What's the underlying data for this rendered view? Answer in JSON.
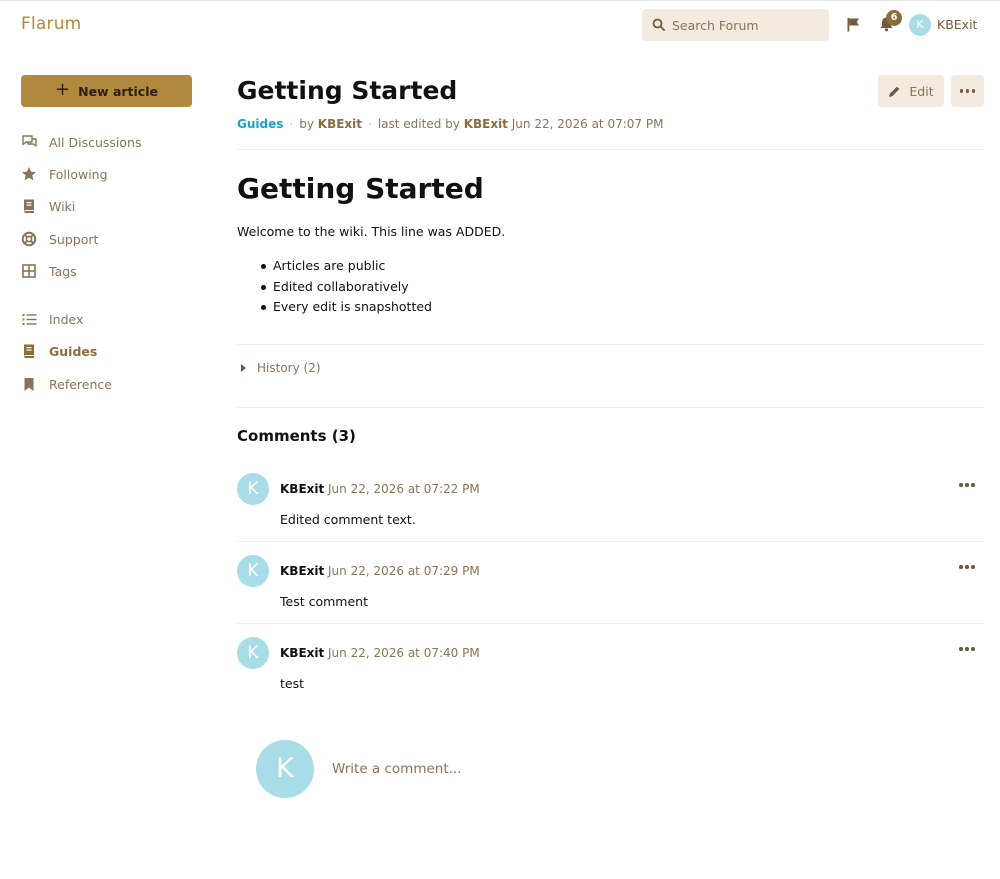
{
  "header": {
    "brand": "Flarum",
    "search_placeholder": "Search Forum",
    "notification_count": "6",
    "user_initial": "K",
    "username": "KBExit"
  },
  "sidebar": {
    "new_article_label": "New article",
    "items": [
      {
        "label": "All Discussions",
        "icon": "comments-icon"
      },
      {
        "label": "Following",
        "icon": "star-icon"
      },
      {
        "label": "Wiki",
        "icon": "book-icon"
      },
      {
        "label": "Support",
        "icon": "lifebuoy-icon"
      },
      {
        "label": "Tags",
        "icon": "tags-grid-icon"
      },
      {
        "label": "Index",
        "icon": "list-icon"
      },
      {
        "label": "Guides",
        "icon": "book-icon",
        "active": true
      },
      {
        "label": "Reference",
        "icon": "bookmark-icon"
      }
    ]
  },
  "article": {
    "title": "Getting Started",
    "tag": "Guides",
    "by_prefix": "by",
    "author": "KBExit",
    "edited_prefix": "last edited by",
    "editor": "KBExit",
    "edited_time": "Jun 22, 2026 at 07:07 PM",
    "edit_label": "Edit",
    "body_heading": "Getting Started",
    "body_text": "Welcome to the wiki. This line was ADDED.",
    "body_list": [
      "Articles are public",
      "Edited collaboratively",
      "Every edit is snapshotted"
    ],
    "history_label": "History (2)"
  },
  "comments": {
    "heading": "Comments (3)",
    "items": [
      {
        "initial": "K",
        "author": "KBExit",
        "time": "Jun 22, 2026 at 07:22 PM",
        "text": "Edited comment text."
      },
      {
        "initial": "K",
        "author": "KBExit",
        "time": "Jun 22, 2026 at 07:29 PM",
        "text": "Test comment"
      },
      {
        "initial": "K",
        "author": "KBExit",
        "time": "Jun 22, 2026 at 07:40 PM",
        "text": "test"
      }
    ],
    "reply_initial": "K",
    "reply_placeholder": "Write a comment..."
  },
  "colors": {
    "accent": "#b0893e",
    "accent_dark": "#8a6d3b",
    "tag_color": "#1aa3c6",
    "avatar_bg": "#a8dce6",
    "button_bg": "#f3ebe0"
  }
}
